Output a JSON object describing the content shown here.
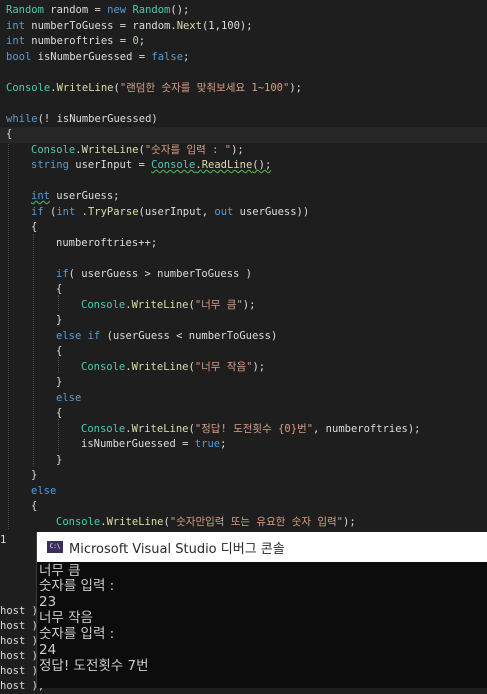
{
  "code": {
    "l1": {
      "ty1": "Random",
      "a": " random = ",
      "kw1": "new",
      "b": " ",
      "ty2": "Random",
      "c": "();"
    },
    "l2": {
      "kw1": "int",
      "a": " numberToGuess = random.",
      "mt1": "Next",
      "b": "(1,100);"
    },
    "l3": {
      "kw1": "int",
      "a": " numberoftries = ",
      "nm1": "0",
      "b": ";"
    },
    "l4": {
      "kw1": "bool",
      "a": " isNumberGuessed = ",
      "kw2": "false",
      "b": ";"
    },
    "l5": {
      "ty1": "Console",
      "a": ".",
      "mt1": "WriteLine",
      "b": "(",
      "st1": "\"랜덤한 숫자를 맞춰보세요 1~100\"",
      "c": ");"
    },
    "l6": {
      "kw1": "while",
      "a": "(! isNumberGuessed)"
    },
    "l7": {
      "a": "{"
    },
    "l8": {
      "ty1": "Console",
      "a": ".",
      "mt1": "WriteLine",
      "b": "(",
      "st1": "\"숫자를 입력 : \"",
      "c": ");"
    },
    "l9": {
      "kw1": "string",
      "a": " userInput = ",
      "ty1": "Console",
      "b": ".",
      "mt1": "ReadLine",
      "c": "();"
    },
    "l10": {
      "kw1": "int",
      "a": " userGuess;"
    },
    "l11": {
      "kw1": "if",
      "a": " (",
      "kw2": "int",
      "b": " .",
      "mt1": "TryParse",
      "c": "(userInput, ",
      "kw3": "out",
      "d": " userGuess))"
    },
    "l12": {
      "a": "{"
    },
    "l13": {
      "a": "numberoftries++;"
    },
    "l14": {
      "kw1": "if",
      "a": "( userGuess > numberToGuess )"
    },
    "l15": {
      "a": "{"
    },
    "l16": {
      "ty1": "Console",
      "a": ".",
      "mt1": "WriteLine",
      "b": "(",
      "st1": "\"너무 큼\"",
      "c": ");"
    },
    "l17": {
      "a": "}"
    },
    "l18": {
      "kw1": "else if",
      "a": " (userGuess < numberToGuess)"
    },
    "l19": {
      "a": "{"
    },
    "l20": {
      "ty1": "Console",
      "a": ".",
      "mt1": "WriteLine",
      "b": "(",
      "st1": "\"너무 작음\"",
      "c": ");"
    },
    "l21": {
      "a": "}"
    },
    "l22": {
      "kw1": "else"
    },
    "l23": {
      "a": "{"
    },
    "l24": {
      "ty1": "Console",
      "a": ".",
      "mt1": "WriteLine",
      "b": "(",
      "st1": "\"정답! 도전횟수 {0}번\"",
      "c": ", numberoftries);"
    },
    "l25": {
      "a": "isNumberGuessed = ",
      "kw1": "true",
      "b": ";"
    },
    "l26": {
      "a": "}"
    },
    "l27": {
      "a": "}"
    },
    "l28": {
      "kw1": "else"
    },
    "l29": {
      "a": "{"
    },
    "l30": {
      "ty1": "Console",
      "a": ".",
      "mt1": "WriteLine",
      "b": "(",
      "st1": "\"숫자만입력 또는 유요한 숫자 입력\"",
      "c": ");"
    }
  },
  "left_strip": {
    "line_number": "1",
    "items": [
      "host );",
      "host );",
      "host );",
      "host );",
      "host );",
      "host );",
      "host )."
    ]
  },
  "console": {
    "icon": "C:\\",
    "title": "Microsoft Visual Studio 디버그 콘솔",
    "lines": [
      "너무 큼",
      "숫자를 입력 :",
      "23",
      "너무 작음",
      "숫자를 입력 :",
      "24",
      "정답! 도전횟수 7번"
    ]
  },
  "colors": {
    "editor_bg": "#1e1e1e",
    "keyword": "#569cd6",
    "type": "#4ec9b0",
    "method": "#dcdcaa",
    "string": "#d69d85",
    "console_bg": "#0c0c0c",
    "console_titlebar": "#ffffff"
  }
}
